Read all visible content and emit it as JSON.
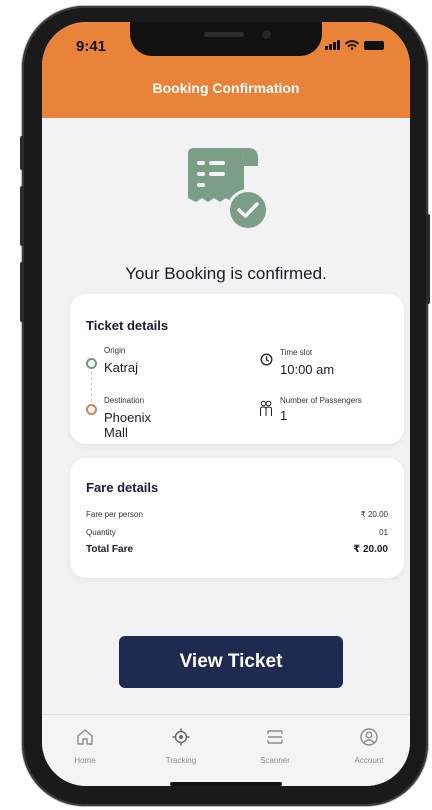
{
  "status_bar": {
    "time": "9:41"
  },
  "header": {
    "title": "Booking Confirmation"
  },
  "confirmation": {
    "message": "Your Booking is confirmed."
  },
  "ticket_details": {
    "title": "Ticket details",
    "origin_label": "Origin",
    "origin_value": "Katraj",
    "destination_label": "Destination",
    "destination_value_line1": "Phoenix",
    "destination_value_line2": "Mall",
    "time_slot_label": "Time slot",
    "time_slot_value": "10:00 am",
    "passengers_label": "Number of Passengers",
    "passengers_value": "1"
  },
  "fare_details": {
    "title": "Fare details",
    "rows": [
      {
        "label": "Fare per person",
        "value": "₹ 20.00"
      },
      {
        "label": "Quantity",
        "value": "01"
      },
      {
        "label": "Total Fare",
        "value": "₹ 20.00"
      }
    ]
  },
  "cta": {
    "label": "View Ticket"
  },
  "tabs": [
    {
      "label": "Home",
      "icon": "home-icon"
    },
    {
      "label": "Tracking",
      "icon": "crosshair-icon"
    },
    {
      "label": "Scanner",
      "icon": "scanner-icon"
    },
    {
      "label": "Account",
      "icon": "account-icon"
    }
  ],
  "colors": {
    "header": "#e9833a",
    "primary_button": "#1e2a4f",
    "icon_green": "#7a9e86",
    "origin_ring": "#6f9a7a",
    "destination_ring": "#d4815a"
  }
}
